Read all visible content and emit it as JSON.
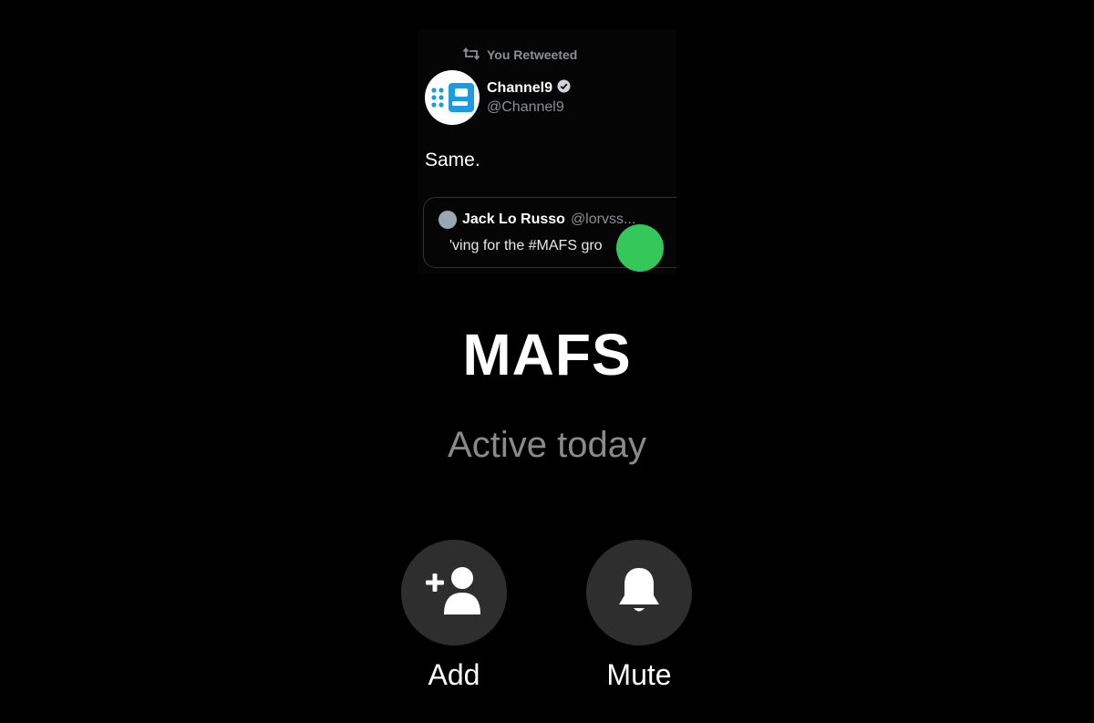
{
  "profile_photo": {
    "retweet_label": "You Retweeted",
    "author": {
      "display_name": "Channel9",
      "handle": "@Channel9",
      "verified": true,
      "avatar_icon": "channel9-logo"
    },
    "tweet_text": "Same.",
    "quoted_tweet": {
      "display_name": "Jack Lo Russo",
      "handle": "@lorvss...",
      "text": "'ving for the #MAFS gro"
    },
    "online_indicator_color": "#34c759"
  },
  "group": {
    "name": "MAFS",
    "presence": "Active today"
  },
  "actions": [
    {
      "label": "Add",
      "icon": "add-person-icon"
    },
    {
      "label": "Mute",
      "icon": "bell-icon"
    }
  ],
  "colors": {
    "background": "#000000",
    "button_bg": "#2e2e2e",
    "online": "#34c759",
    "secondary_text": "#8a8a8a"
  }
}
